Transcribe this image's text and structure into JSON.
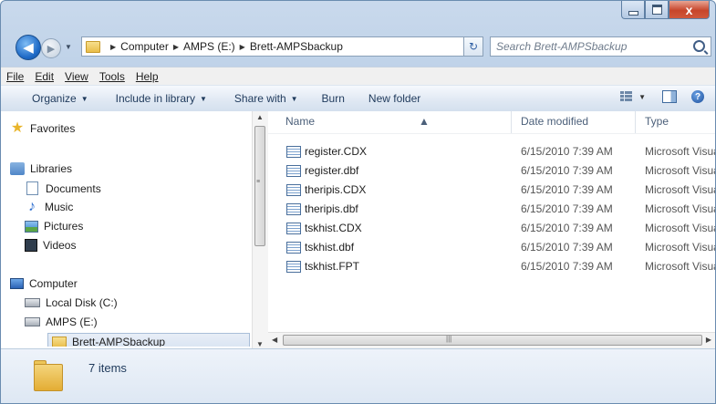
{
  "window": {
    "close_glyph": "x"
  },
  "address": {
    "crumbs": [
      "Computer",
      "AMPS (E:)",
      "Brett-AMPSbackup"
    ],
    "search_placeholder": "Search Brett-AMPSbackup"
  },
  "menu": {
    "file": "File",
    "edit": "Edit",
    "view": "View",
    "tools": "Tools",
    "help": "Help"
  },
  "toolbar": {
    "organize": "Organize",
    "include_in_library": "Include in library",
    "share_with": "Share with",
    "burn": "Burn",
    "new_folder": "New folder"
  },
  "sidebar": {
    "favorites": "Favorites",
    "libraries": "Libraries",
    "documents": "Documents",
    "music": "Music",
    "pictures": "Pictures",
    "videos": "Videos",
    "computer": "Computer",
    "local_disk": "Local Disk (C:)",
    "amps": "AMPS (E:)",
    "brett": "Brett-AMPSbackup"
  },
  "columns": {
    "name": "Name",
    "date": "Date modified",
    "type": "Type"
  },
  "files": [
    {
      "name": "register.CDX",
      "date": "6/15/2010 7:39 AM",
      "type": "Microsoft Visual F"
    },
    {
      "name": "register.dbf",
      "date": "6/15/2010 7:39 AM",
      "type": "Microsoft Visual F"
    },
    {
      "name": "theripis.CDX",
      "date": "6/15/2010 7:39 AM",
      "type": "Microsoft Visual F"
    },
    {
      "name": "theripis.dbf",
      "date": "6/15/2010 7:39 AM",
      "type": "Microsoft Visual F"
    },
    {
      "name": "tskhist.CDX",
      "date": "6/15/2010 7:39 AM",
      "type": "Microsoft Visual F"
    },
    {
      "name": "tskhist.dbf",
      "date": "6/15/2010 7:39 AM",
      "type": "Microsoft Visual F"
    },
    {
      "name": "tskhist.FPT",
      "date": "6/15/2010 7:39 AM",
      "type": "Microsoft Visual F"
    }
  ],
  "status": {
    "items": "7 items"
  }
}
